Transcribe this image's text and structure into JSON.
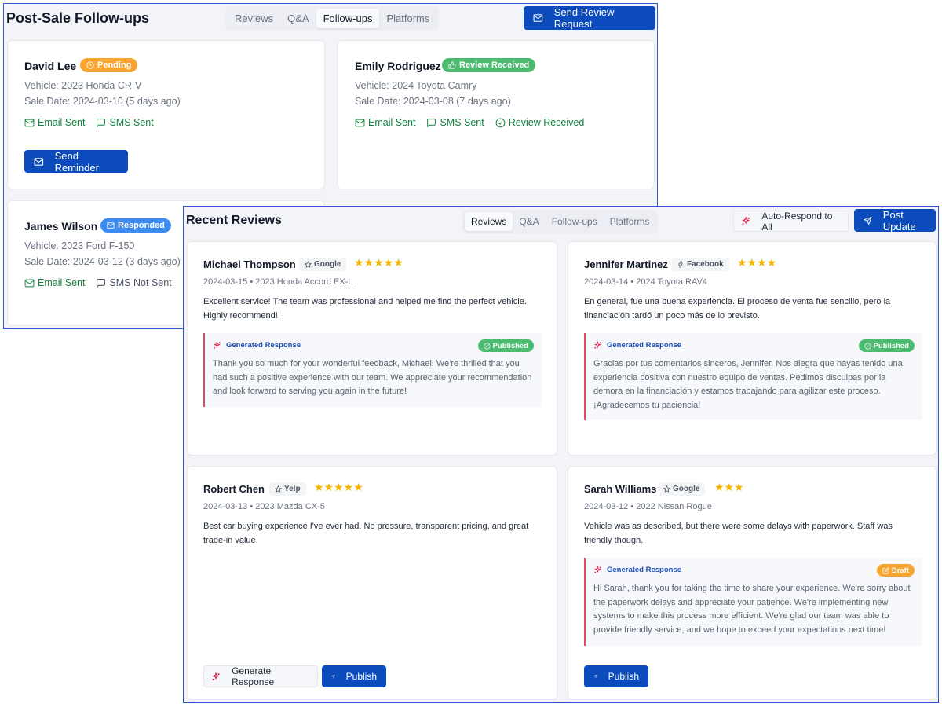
{
  "followups": {
    "title": "Post-Sale Follow-ups",
    "tabs": [
      "Reviews",
      "Q&A",
      "Follow-ups",
      "Platforms"
    ],
    "active_tab": "Follow-ups",
    "send_request_label": "Send Review Request",
    "cards": [
      {
        "name": "David Lee",
        "status": "Pending",
        "vehicle": "Vehicle: 2023 Honda CR-V",
        "sale_date": "Sale Date: 2024-03-10 (5 days ago)",
        "statuses": [
          "Email Sent",
          "SMS Sent"
        ],
        "action": "Send Reminder"
      },
      {
        "name": "Emily Rodriguez",
        "status": "Review Received",
        "vehicle": "Vehicle: 2024 Toyota Camry",
        "sale_date": "Sale Date: 2024-03-08 (7 days ago)",
        "statuses": [
          "Email Sent",
          "SMS Sent",
          "Review Received"
        ]
      },
      {
        "name": "James Wilson",
        "status": "Responded",
        "vehicle": "Vehicle: 2023 Ford F-150",
        "sale_date": "Sale Date: 2024-03-12 (3 days ago)",
        "statuses": [
          "Email Sent",
          "SMS Not Sent"
        ]
      }
    ]
  },
  "reviews": {
    "title": "Recent Reviews",
    "tabs": [
      "Reviews",
      "Q&A",
      "Follow-ups",
      "Platforms"
    ],
    "active_tab": "Reviews",
    "auto_respond_label": "Auto-Respond to All",
    "post_update_label": "Post Update",
    "cards": [
      {
        "name": "Michael Thompson",
        "platform": "Google",
        "rating": 5,
        "stars": "★★★★★",
        "meta": "2024-03-15 • 2023 Honda Accord EX-L",
        "text": "Excellent service! The team was professional and helped me find the perfect vehicle. Highly recommend!",
        "response_label": "Generated Response",
        "response_status": "Published",
        "response": "Thank you so much for your wonderful feedback, Michael! We're thrilled that you had such a positive experience with our team. We appreciate your recommendation and look forward to serving you again in the future!"
      },
      {
        "name": "Jennifer Martinez",
        "platform": "Facebook",
        "rating": 4,
        "stars": "★★★★",
        "meta": "2024-03-14 • 2024 Toyota RAV4",
        "text": "En general, fue una buena experiencia. El proceso de venta fue sencillo, pero la financiación tardó un poco más de lo previsto.",
        "response_label": "Generated Response",
        "response_status": "Published",
        "response": "Gracias por tus comentarios sinceros, Jennifer. Nos alegra que hayas tenido una experiencia positiva con nuestro equipo de ventas. Pedimos disculpas por la demora en la financiación y estamos trabajando para agilizar este proceso. ¡Agradecemos tu paciencia!"
      },
      {
        "name": "Robert Chen",
        "platform": "Yelp",
        "rating": 5,
        "stars": "★★★★★",
        "meta": "2024-03-13 • 2023 Mazda CX-5",
        "text": "Best car buying experience I've ever had. No pressure, transparent pricing, and great trade-in value.",
        "generate_label": "Generate Response",
        "publish_label": "Publish"
      },
      {
        "name": "Sarah Williams",
        "platform": "Google",
        "rating": 3,
        "stars": "★★★",
        "meta": "2024-03-12 • 2022 Nissan Rogue",
        "text": "Vehicle was as described, but there were some delays with paperwork. Staff was friendly though.",
        "response_label": "Generated Response",
        "response_status": "Draft",
        "response": "Hi Sarah, thank you for taking the time to share your experience. We're sorry about the paperwork delays and appreciate your patience. We're implementing new systems to make this process more efficient. We're glad our team was able to provide friendly service, and we hope to exceed your expectations next time!",
        "publish_label": "Publish"
      }
    ]
  },
  "icons": {
    "mail": "mail-icon",
    "message": "message-square-icon",
    "check_circle": "check-circle-icon",
    "clock": "clock-icon",
    "thumbs_up": "thumbs-up-icon",
    "send": "send-icon",
    "sparkles": "sparkles-icon",
    "star_outline": "star-outline-icon",
    "facebook": "facebook-icon",
    "edit": "edit-icon"
  },
  "colors": {
    "primary": "#0b4bbb",
    "panel_border": "#2a5bd7",
    "pending": "#f7a430",
    "received": "#4cbb6f",
    "responded": "#3e8bf0",
    "success_text": "#15803d",
    "star": "#f4b400",
    "accent_red": "#e44a5e"
  }
}
